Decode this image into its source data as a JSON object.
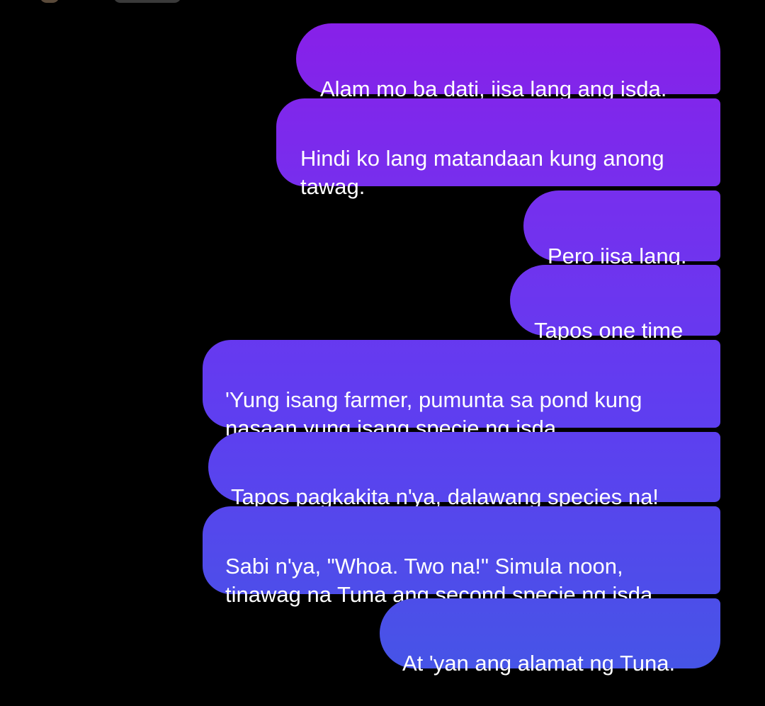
{
  "messages": [
    {
      "id": "b1",
      "text": "Alam mo ba dati, iisa lang ang isda."
    },
    {
      "id": "b2",
      "text": "Hindi ko lang matandaan kung anong\ntawag."
    },
    {
      "id": "b3",
      "text": "Pero iisa lang."
    },
    {
      "id": "b4",
      "text": "Tapos one time"
    },
    {
      "id": "b5",
      "text": "'Yung isang farmer, pumunta sa pond kung\nnasaan yung isang specie ng isda."
    },
    {
      "id": "b6",
      "text": "Tapos pagkakita n'ya, dalawang species na!"
    },
    {
      "id": "b7",
      "text": "Sabi n'ya, \"Whoa. Two na!\" Simula noon,\ntinawag na Tuna ang second specie ng isda."
    },
    {
      "id": "b8",
      "text": "At 'yan ang alamat ng Tuna."
    }
  ],
  "colors": {
    "background": "#000000",
    "bubble_top": "#8a1ee8",
    "bubble_bottom": "#4456e6",
    "text": "#ffffff"
  }
}
